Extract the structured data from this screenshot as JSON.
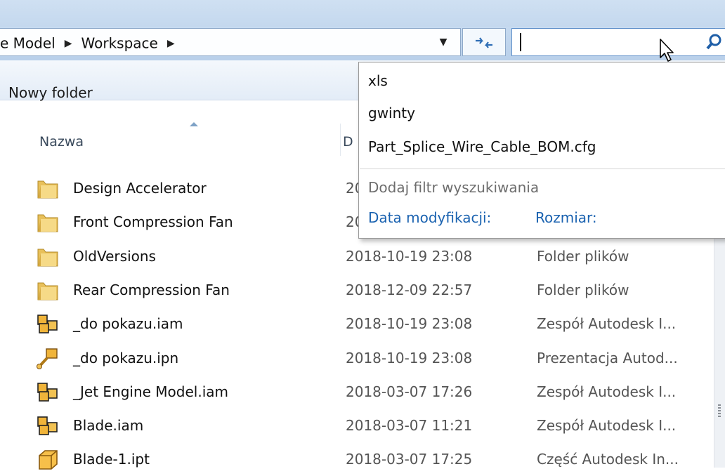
{
  "address": {
    "crumbs": [
      "e Model",
      "Workspace"
    ],
    "arrow": "▶",
    "dropdown": "▼"
  },
  "search": {
    "value": ""
  },
  "toolbar": {
    "new_folder": "Nowy folder"
  },
  "columns": {
    "name": "Nazwa",
    "date": "D"
  },
  "files": [
    {
      "name": "Design Accelerator",
      "date": "20",
      "type": "",
      "icon": "folder-icon"
    },
    {
      "name": "Front Compression Fan",
      "date": "20",
      "type": "",
      "icon": "folder-icon"
    },
    {
      "name": "OldVersions",
      "date": "2018-10-19 23:08",
      "type": "Folder plików",
      "icon": "folder-icon"
    },
    {
      "name": "Rear Compression Fan",
      "date": "2018-12-09 22:57",
      "type": "Folder plików",
      "icon": "folder-icon"
    },
    {
      "name": "_do pokazu.iam",
      "date": "2018-10-19 23:08",
      "type": "Zespół Autodesk I...",
      "icon": "assembly-icon"
    },
    {
      "name": "_do pokazu.ipn",
      "date": "2018-10-19 23:08",
      "type": "Prezentacja Autod...",
      "icon": "presentation-icon"
    },
    {
      "name": "_Jet Engine Model.iam",
      "date": "2018-03-07 17:26",
      "type": "Zespół Autodesk I...",
      "icon": "assembly-icon"
    },
    {
      "name": "Blade.iam",
      "date": "2018-03-07 11:21",
      "type": "Zespół Autodesk I...",
      "icon": "assembly-icon"
    },
    {
      "name": "Blade-1.ipt",
      "date": "2018-03-07 17:25",
      "type": "Część Autodesk In...",
      "icon": "part-icon"
    }
  ],
  "suggestions": {
    "items": [
      "xls",
      "gwinty",
      "Part_Splice_Wire_Cable_BOM.cfg"
    ],
    "add_filter": "Dodaj filtr wyszukiwania",
    "filters": [
      "Data modyfikacji:",
      "Rozmiar:"
    ]
  }
}
